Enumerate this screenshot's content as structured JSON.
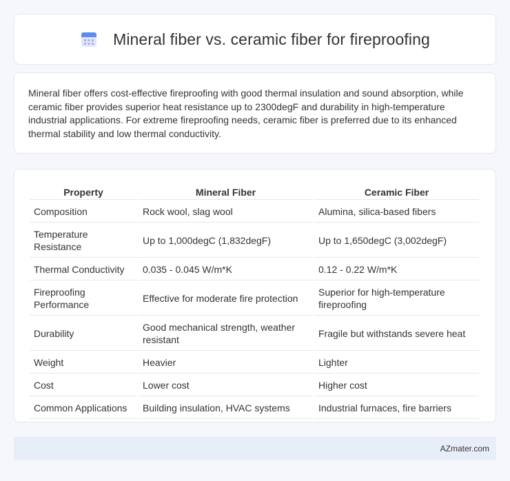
{
  "header": {
    "icon": "calendar-icon",
    "title": "Mineral fiber vs. ceramic fiber for fireproofing"
  },
  "summary": {
    "text": "Mineral fiber offers cost-effective fireproofing with good thermal insulation and sound absorption, while ceramic fiber provides superior heat resistance up to 2300degF and durability in high-temperature industrial applications. For extreme fireproofing needs, ceramic fiber is preferred due to its enhanced thermal stability and low thermal conductivity."
  },
  "table": {
    "headers": [
      "Property",
      "Mineral Fiber",
      "Ceramic Fiber"
    ],
    "rows": [
      [
        "Composition",
        "Rock wool, slag wool",
        "Alumina, silica-based fibers"
      ],
      [
        "Temperature Resistance",
        "Up to 1,000degC (1,832degF)",
        "Up to 1,650degC (3,002degF)"
      ],
      [
        "Thermal Conductivity",
        "0.035 - 0.045 W/m*K",
        "0.12 - 0.22 W/m*K"
      ],
      [
        "Fireproofing Performance",
        "Effective for moderate fire protection",
        "Superior for high-temperature fireproofing"
      ],
      [
        "Durability",
        "Good mechanical strength, weather resistant",
        "Fragile but withstands severe heat"
      ],
      [
        "Weight",
        "Heavier",
        "Lighter"
      ],
      [
        "Cost",
        "Lower cost",
        "Higher cost"
      ],
      [
        "Common Applications",
        "Building insulation, HVAC systems",
        "Industrial furnaces, fire barriers"
      ]
    ]
  },
  "footer": {
    "brand": "AZmater.com"
  },
  "colors": {
    "background": "#f5f7fb",
    "card": "#ffffff",
    "border": "#e3e7ee",
    "footer": "#e8eef8",
    "icon_accent": "#5b8def",
    "icon_body": "#dfe8fb"
  }
}
